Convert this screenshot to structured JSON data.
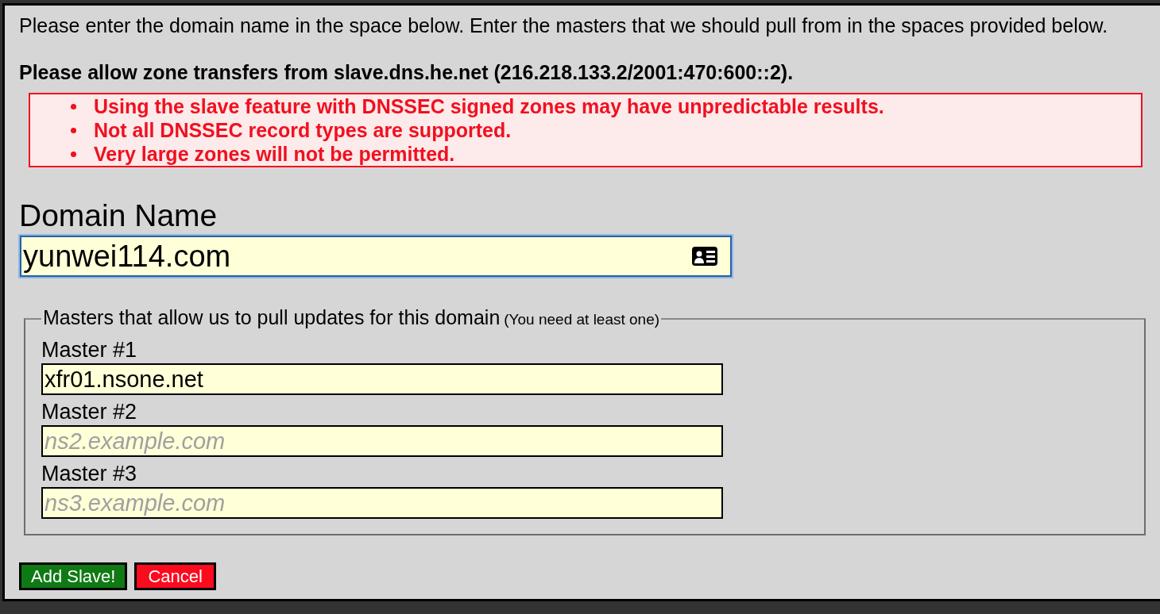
{
  "intro": "Please enter the domain name in the space below. Enter the masters that we should pull from in the spaces provided below.",
  "notice": "Please allow zone transfers from slave.dns.he.net (216.218.133.2/2001:470:600::2).",
  "warnings": [
    "Using the slave feature with DNSSEC signed zones may have unpredictable results.",
    "Not all DNSSEC record types are supported.",
    "Very large zones will not be permitted."
  ],
  "domain": {
    "label": "Domain Name",
    "value": "yunwei114.com",
    "focused": true
  },
  "masters": {
    "legend": "Masters that allow us to pull updates for this domain",
    "legend_note": "(You need at least one)",
    "fields": [
      {
        "label": "Master #1",
        "value": "xfr01.nsone.net"
      },
      {
        "label": "Master #2",
        "placeholder": "ns2.example.com"
      },
      {
        "label": "Master #3",
        "placeholder": "ns3.example.com"
      }
    ]
  },
  "buttons": [
    {
      "label": "Add Slave!",
      "kind": "primary"
    },
    {
      "label": "Cancel",
      "kind": "cancel"
    }
  ]
}
